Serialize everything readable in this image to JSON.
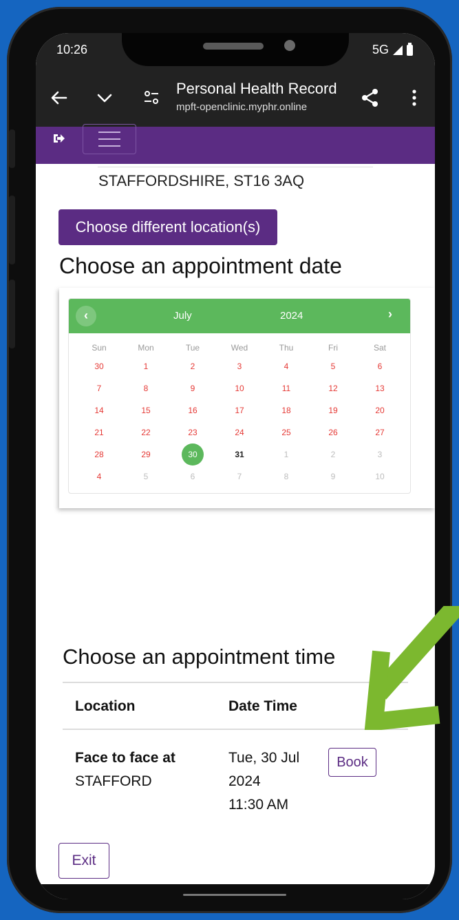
{
  "status_bar": {
    "time": "10:26",
    "network": "5G"
  },
  "browser": {
    "page_title": "Personal Health Record",
    "url": "mpft-openclinic.myphr.online",
    "icons": [
      "back-arrow-icon",
      "chevron-down-icon",
      "tune-icon",
      "share-icon",
      "more-vert-icon"
    ]
  },
  "app_bar": {
    "icons": [
      "sign-out-icon",
      "hamburger-menu-icon"
    ],
    "color": "#5b2c83"
  },
  "location": {
    "address": "STAFFORDSHIRE, ST16 3AQ",
    "change_button": "Choose different location(s)"
  },
  "date_section": {
    "heading": "Choose an appointment date",
    "calendar": {
      "month": "July",
      "year": "2024",
      "prev_label": "‹",
      "next_label": "›",
      "weekdays": [
        "Sun",
        "Mon",
        "Tue",
        "Wed",
        "Thu",
        "Fri",
        "Sat"
      ],
      "weeks": [
        [
          "30",
          "1",
          "2",
          "3",
          "4",
          "5",
          "6"
        ],
        [
          "7",
          "8",
          "9",
          "10",
          "11",
          "12",
          "13"
        ],
        [
          "14",
          "15",
          "16",
          "17",
          "18",
          "19",
          "20"
        ],
        [
          "21",
          "22",
          "23",
          "24",
          "25",
          "26",
          "27"
        ],
        [
          "28",
          "29",
          "30",
          "31",
          "1",
          "2",
          "3"
        ],
        [
          "4",
          "5",
          "6",
          "7",
          "8",
          "9",
          "10"
        ]
      ],
      "styles": [
        [
          "red",
          "red",
          "red",
          "red",
          "red",
          "red",
          "red"
        ],
        [
          "red",
          "red",
          "red",
          "red",
          "red",
          "red",
          "red"
        ],
        [
          "red",
          "red",
          "red",
          "red",
          "red",
          "red",
          "red"
        ],
        [
          "red",
          "red",
          "red",
          "red",
          "red",
          "red",
          "red"
        ],
        [
          "red",
          "red",
          "selected",
          "bold",
          "muted",
          "muted",
          "muted"
        ],
        [
          "red",
          "muted",
          "muted",
          "muted",
          "muted",
          "muted",
          "muted"
        ]
      ],
      "header_color": "#5cb85c"
    }
  },
  "time_section": {
    "heading": "Choose an appointment time",
    "columns": [
      "Location",
      "Date Time"
    ],
    "row": {
      "location_title": "Face to face at",
      "location_name": "STAFFORD",
      "date_line1": "Tue, 30 Jul",
      "date_line2": "2024",
      "time": "11:30 AM",
      "book_label": "Book"
    }
  },
  "exit_label": "Exit",
  "annotation": {
    "color": "#7cb82f"
  }
}
